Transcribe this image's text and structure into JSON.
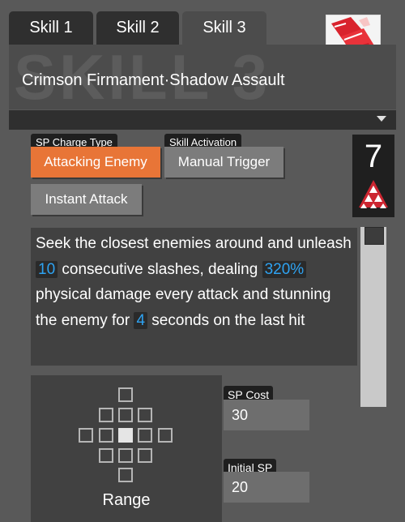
{
  "tabs": [
    {
      "label": "Skill 1",
      "active": false
    },
    {
      "label": "Skill 2",
      "active": false
    },
    {
      "label": "Skill 3",
      "active": true
    }
  ],
  "header": {
    "watermark": "SKILL 3",
    "title": "Crimson Firmament·Shadow Assault"
  },
  "sp_charge": {
    "label": "SP Charge Type",
    "value": "Attacking Enemy"
  },
  "skill_activation": {
    "label": "Skill Activation",
    "value": "Manual Trigger"
  },
  "extra_tag": "Instant Attack",
  "level": "7",
  "description": {
    "part1": "Seek the closest enemies around and unleash ",
    "hits": "10",
    "part2": " consecutive slashes, dealing ",
    "damage": "320%",
    "part3": " physical damage every attack and stunning the enemy for ",
    "stun": "4",
    "part4": " seconds on the last hit"
  },
  "range": {
    "label": "Range"
  },
  "sp_cost": {
    "label": "SP Cost",
    "value": "30"
  },
  "initial_sp": {
    "label": "Initial SP",
    "value": "20"
  },
  "colors": {
    "accent_active": "#e87537",
    "highlight_number": "#2ea3f2",
    "background": "#595959"
  }
}
